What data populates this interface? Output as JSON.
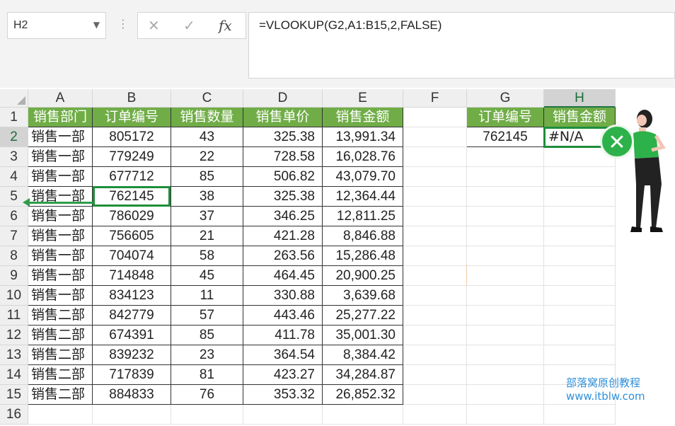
{
  "namebox": {
    "value": "H2"
  },
  "formula": {
    "value": "=VLOOKUP(G2,A1:B15,2,FALSE)",
    "fx_label": "fx"
  },
  "columns": [
    "A",
    "B",
    "C",
    "D",
    "E",
    "F",
    "G",
    "H"
  ],
  "rows": [
    "1",
    "2",
    "3",
    "4",
    "5",
    "6",
    "7",
    "8",
    "9",
    "10",
    "11",
    "12",
    "13",
    "14",
    "15",
    "16"
  ],
  "table": {
    "headers": [
      "销售部门",
      "订单编号",
      "销售数量",
      "销售单价",
      "销售金额"
    ],
    "rows": [
      [
        "销售一部",
        "805172",
        "43",
        "325.38",
        "13,991.34"
      ],
      [
        "销售一部",
        "779249",
        "22",
        "728.58",
        "16,028.76"
      ],
      [
        "销售一部",
        "677712",
        "85",
        "506.82",
        "43,079.70"
      ],
      [
        "销售一部",
        "762145",
        "38",
        "325.38",
        "12,364.44"
      ],
      [
        "销售一部",
        "786029",
        "37",
        "346.25",
        "12,811.25"
      ],
      [
        "销售一部",
        "756605",
        "21",
        "421.28",
        "8,846.88"
      ],
      [
        "销售一部",
        "704074",
        "58",
        "263.56",
        "15,286.48"
      ],
      [
        "销售一部",
        "714848",
        "45",
        "464.45",
        "20,900.25"
      ],
      [
        "销售一部",
        "834123",
        "11",
        "330.88",
        "3,639.68"
      ],
      [
        "销售二部",
        "842779",
        "57",
        "443.46",
        "25,277.22"
      ],
      [
        "销售二部",
        "674391",
        "85",
        "411.78",
        "35,001.30"
      ],
      [
        "销售二部",
        "839232",
        "23",
        "364.54",
        "8,384.42"
      ],
      [
        "销售二部",
        "717839",
        "81",
        "423.27",
        "34,284.87"
      ],
      [
        "销售二部",
        "884833",
        "76",
        "353.32",
        "26,852.32"
      ]
    ]
  },
  "lookup": {
    "headers": [
      "订单编号",
      "销售金额"
    ],
    "key": "762145",
    "result": "#N/A"
  },
  "icons": {
    "cancel": "close-icon",
    "confirm": "check-icon",
    "function": "fx-icon",
    "error_badge": "error-x-icon"
  },
  "watermark": {
    "line1": "部落窝原创教程",
    "line2": "www.itblw.com"
  },
  "colors": {
    "header_green": "#70ad47",
    "selection_green": "#1e8f3a",
    "watermark_blue": "#2f8fd8"
  }
}
